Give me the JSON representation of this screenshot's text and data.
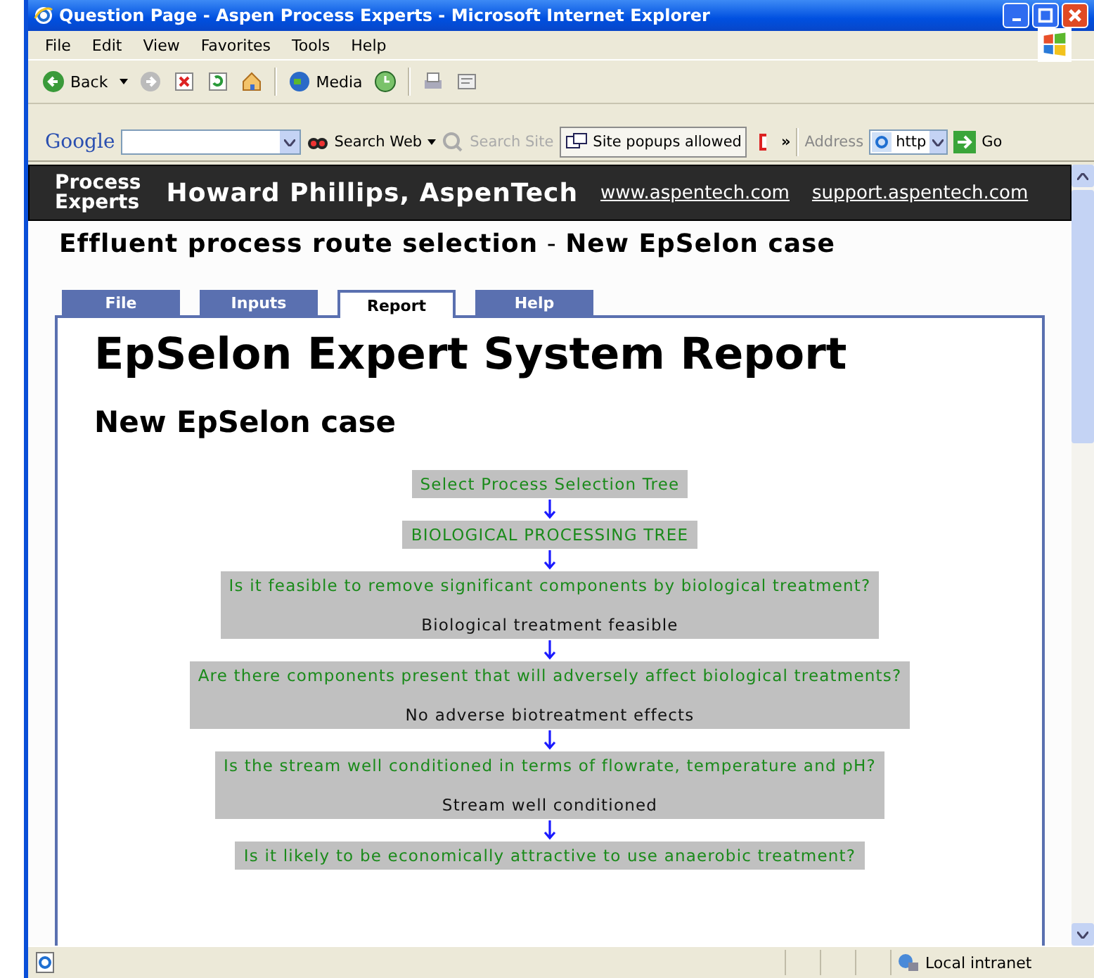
{
  "window": {
    "title": "Question Page - Aspen Process Experts - Microsoft Internet Explorer"
  },
  "menu": [
    "File",
    "Edit",
    "View",
    "Favorites",
    "Tools",
    "Help"
  ],
  "toolbar": {
    "back": "Back",
    "media": "Media"
  },
  "google_bar": {
    "logo": "Google",
    "search_web": "Search Web",
    "search_site": "Search Site",
    "popups": "Site popups allowed",
    "more": "»",
    "address_label": "Address",
    "address_value": "http",
    "go": "Go"
  },
  "header": {
    "logo_lines": [
      "Process",
      "Experts"
    ],
    "author": "Howard Phillips, AspenTech",
    "links": [
      "www.aspentech.com",
      "support.aspentech.com"
    ]
  },
  "page_title": "**Effluent process route selection** - **New EpSelon case**",
  "tabs": [
    {
      "label": "File",
      "selected": false
    },
    {
      "label": "Inputs",
      "selected": false
    },
    {
      "label": "Report",
      "selected": true
    },
    {
      "label": "Help",
      "selected": false
    }
  ],
  "report": {
    "title": "EpSelon Expert System Report",
    "subtitle": "New EpSelon case",
    "flow": [
      {
        "question": "Select Process Selection Tree"
      },
      {
        "question": "BIOLOGICAL PROCESSING TREE"
      },
      {
        "question": "Is it feasible to remove significant components by biological treatment?",
        "answer": "Biological treatment feasible"
      },
      {
        "question": "Are there components present that will adversely affect biological treatments?",
        "answer": "No adverse biotreatment effects"
      },
      {
        "question": "Is the stream well conditioned in terms of flowrate, temperature and pH?",
        "answer": "Stream well conditioned"
      },
      {
        "question": "Is it likely to be economically attractive to use anaerobic treatment?"
      }
    ]
  },
  "status_bar": {
    "zone": "Local intranet"
  }
}
